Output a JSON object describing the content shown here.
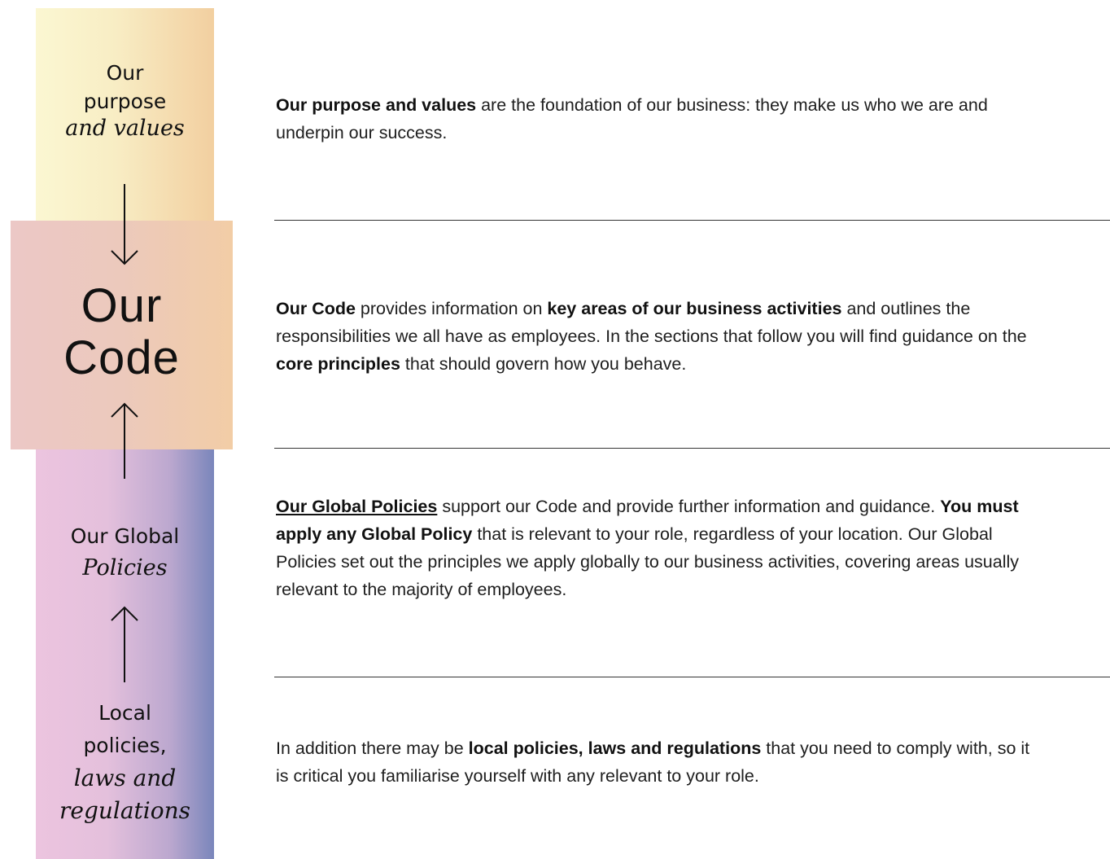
{
  "left_column": {
    "purpose": {
      "line1": "Our",
      "line2": "purpose",
      "line3": "and values"
    },
    "code": {
      "line1": "Our",
      "line2": "Code"
    },
    "global": {
      "line1": "Our Global",
      "line2": "Policies"
    },
    "local": {
      "line1": "Local",
      "line2": "policies,",
      "line3": "laws and",
      "line4": "regulations"
    }
  },
  "paragraphs": {
    "purpose": {
      "b1": "Our purpose and values",
      "t1": " are the foundation of our business: they make us who we are and underpin our success."
    },
    "code": {
      "b1": "Our Code",
      "t1": " provides information on ",
      "b2": "key areas of our business activities",
      "t2": " and outlines the responsibilities we all have as employees. In the sections that follow you will find guidance on the ",
      "b3": "core principles",
      "t3": " that should govern how you behave."
    },
    "global": {
      "link": "Our Global Policies",
      "t1": " support our Code and provide further information and guidance. ",
      "b1": "You must apply any Global Policy",
      "t2": " that is relevant to your role, regardless of your location. Our Global Policies set out the principles we apply globally to our business activities, covering areas usually relevant to the majority of employees."
    },
    "local": {
      "t1": "In addition there may be ",
      "b1": "local policies, laws and regulations",
      "t2": " that you need to comply with, so it is critical you familiarise yourself with any relevant to your role."
    }
  },
  "colors": {
    "purpose_panel": "#f8edc4",
    "code_panel": "#ecc9bc",
    "policies_panel_start": "#ecc4df",
    "policies_panel_end": "#7a86bb",
    "divider": "#333333"
  }
}
